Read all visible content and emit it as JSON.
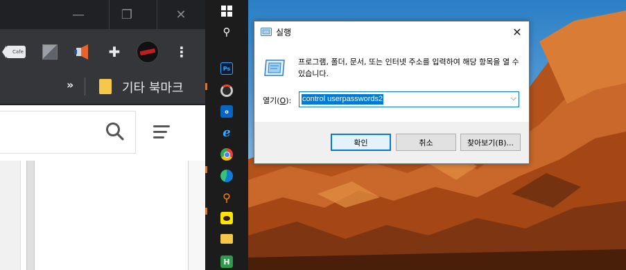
{
  "browser": {
    "window_controls": {
      "minimize": "—",
      "restore": "❐",
      "close": "✕"
    },
    "extensions": {
      "cafe_label": "Cafe",
      "puzzle": "✚",
      "menu": "⋮"
    },
    "bookmarks": {
      "overflow": "»",
      "other_bookmarks_label": "기타 북마크"
    }
  },
  "taskbar": {
    "start_icon": "windows-logo-icon",
    "search_glyph": "⚲",
    "apps": [
      {
        "name": "photoshop",
        "label": "Ps"
      },
      {
        "name": "outlook",
        "label": "o"
      },
      {
        "name": "internet-explorer",
        "label": "e"
      },
      {
        "name": "key-app",
        "label": "⚲"
      },
      {
        "name": "hwp",
        "label": "H"
      }
    ]
  },
  "run_dialog": {
    "title": "실행",
    "close_glyph": "✕",
    "description": "프로그램, 폴더, 문서, 또는 인터넷 주소를 입력하여 해당 항목을 열 수 있습니다.",
    "open_label_prefix": "열기(",
    "open_label_key": "O",
    "open_label_suffix": "):",
    "input_value": "control userpasswords2",
    "dropdown_glyph": "⌵",
    "buttons": {
      "ok": "확인",
      "cancel": "취소",
      "browse": "찾아보기(B)..."
    }
  }
}
